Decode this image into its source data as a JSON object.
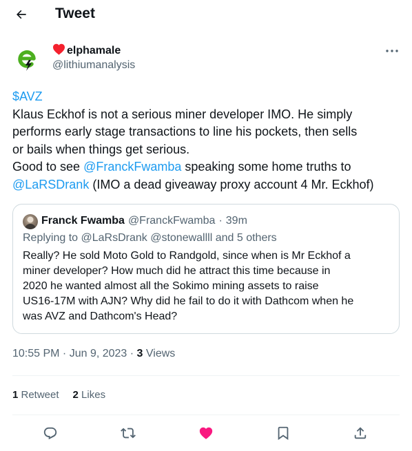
{
  "header": {
    "title": "Tweet"
  },
  "author": {
    "name": "elphamale",
    "handle": "@lithiumanalysis",
    "heart_color": "#f4212e",
    "avatar_color": "#4caf1f"
  },
  "tweet": {
    "lines": [
      [
        {
          "text": "$AVZ",
          "link": true
        }
      ],
      [
        {
          "text": "Klaus Eckhof is not a serious miner developer IMO. He simply",
          "link": false
        }
      ],
      [
        {
          "text": "performs early stage transactions to line his pockets, then sells",
          "link": false
        }
      ],
      [
        {
          "text": "or bails when things get serious.",
          "link": false
        }
      ],
      [
        {
          "text": "Good to see ",
          "link": false
        },
        {
          "text": "@FranckFwamba",
          "link": true
        },
        {
          "text": " speaking some home truths to",
          "link": false
        }
      ],
      [
        {
          "text": "@LaRSDrank",
          "link": true
        },
        {
          "text": " (IMO a dead giveaway proxy account 4 Mr. Eckhof)",
          "link": false
        }
      ]
    ]
  },
  "quote": {
    "name": "Franck Fwamba",
    "handle": "@FranckFwamba",
    "separator": "·",
    "time": "39m",
    "replying_to": "Replying to @LaRsDrank @stonewallll and 5 others",
    "lines": [
      "Really? He sold Moto Gold to Randgold, since when is Mr Eckhof a",
      "miner developer? How much did he attract this time because in",
      "2020 he wanted almost all the Sokimo mining assets to raise",
      "US16-17M with AJN? Why did he fail to do it with Dathcom when he",
      "was AVZ and Dathcom's Head?"
    ]
  },
  "meta": {
    "time": "10:55 PM",
    "separator1": " · ",
    "date": "Jun 9, 2023",
    "separator2": " · ",
    "views_count": "3",
    "views_label": " Views"
  },
  "stats": {
    "retweets_count": "1",
    "retweets_label": " Retweet",
    "likes_count": "2",
    "likes_label": " Likes"
  },
  "colors": {
    "link": "#1d9bf0",
    "muted": "#536471",
    "like_active": "#f91880",
    "border": "#cfd9de"
  }
}
